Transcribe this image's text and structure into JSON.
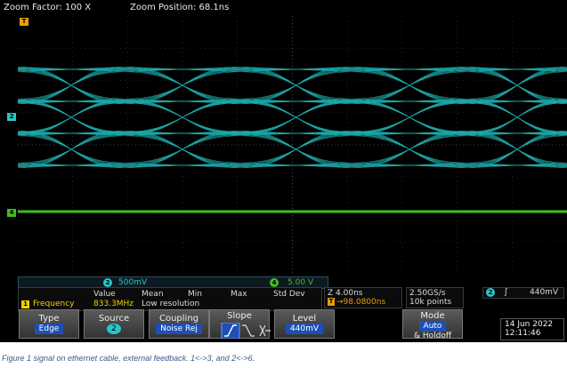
{
  "header": {
    "zoom_factor": "Zoom Factor: 100 X",
    "zoom_position": "Zoom Position: 68.1ns"
  },
  "markers": {
    "trigger": "T",
    "ch2": "2",
    "ch4": "4"
  },
  "scales": {
    "ch2_num": "2",
    "ch2_value": "500mV",
    "ch4_num": "4",
    "ch4_value": "5.00 V"
  },
  "measurements": {
    "headers": [
      "Value",
      "Mean",
      "Min",
      "Max",
      "Std Dev"
    ],
    "badge": "1",
    "name": "Frequency",
    "value": "833.3MHz",
    "note": "Low resolution"
  },
  "timebase": {
    "scale": "Z 4.00ns",
    "trigger_icon": "T",
    "position": "→98.0800ns"
  },
  "acquisition": {
    "rate": "2.50GS/s",
    "points": "10k points"
  },
  "trigger": {
    "channel": "2",
    "slope_symbol": "ʃ",
    "level": "440mV"
  },
  "menu": {
    "type_label": "Type",
    "type_value": "Edge",
    "source_label": "Source",
    "source_value": "2",
    "coupling_label": "Coupling",
    "coupling_value": "Noise Rej",
    "slope_label": "Slope",
    "level_label": "Level",
    "level_value": "440mV",
    "mode_label": "Mode",
    "mode_value": "Auto",
    "mode_extra": "& Holdoff"
  },
  "datetime": {
    "date": "14 Jun 2022",
    "time": "12:11:46"
  },
  "caption": "Figure 1 signal on ethernet cable, external feedback. 1<->3, and 2<->6.",
  "colors": {
    "ch2": "#24c8c8",
    "ch4": "#3fbf1f",
    "trigger": "#e8a000",
    "active": "#1d4fb5"
  }
}
